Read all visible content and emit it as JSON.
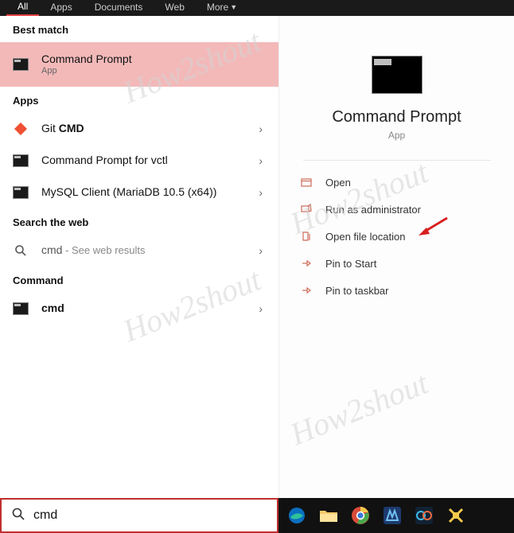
{
  "tabs": {
    "all": "All",
    "apps": "Apps",
    "documents": "Documents",
    "web": "Web",
    "more": "More"
  },
  "sections": {
    "best_match": "Best match",
    "apps": "Apps",
    "search_web": "Search the web",
    "command": "Command"
  },
  "best_match": {
    "title": "Command Prompt",
    "sub": "App"
  },
  "apps_list": {
    "0": {
      "pre": "Git ",
      "bold": "CMD"
    },
    "1": {
      "title": "Command Prompt for vctl"
    },
    "2": {
      "title": "MySQL Client (MariaDB 10.5 (x64))"
    }
  },
  "web": {
    "query": "cmd",
    "hint": " - See web results"
  },
  "cmd_item": {
    "title": "cmd"
  },
  "preview": {
    "name": "Command Prompt",
    "type": "App"
  },
  "actions": {
    "open": "Open",
    "runadmin": "Run as administrator",
    "openloc": "Open file location",
    "pinstart": "Pin to Start",
    "pintask": "Pin to taskbar"
  },
  "search": {
    "value": "cmd"
  },
  "watermark": "How2shout"
}
